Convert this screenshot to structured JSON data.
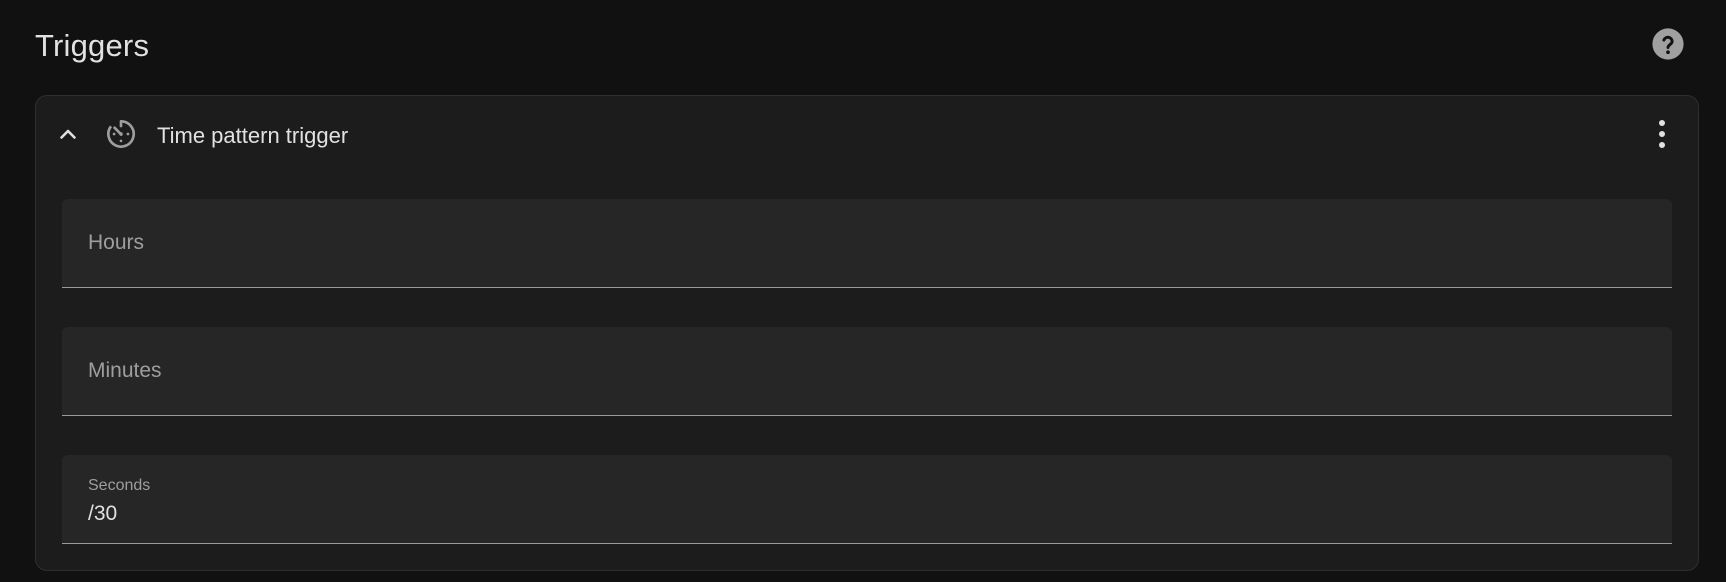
{
  "section": {
    "title": "Triggers",
    "help_icon": "help-circle-icon"
  },
  "trigger": {
    "title": "Time pattern trigger",
    "collapse_icon": "chevron-up-icon",
    "type_icon": "timer-outline-icon",
    "menu_icon": "dots-vertical-icon",
    "fields": {
      "hours": {
        "label": "Hours",
        "value": ""
      },
      "minutes": {
        "label": "Minutes",
        "value": ""
      },
      "seconds": {
        "label": "Seconds",
        "value": "/30"
      }
    }
  },
  "colors": {
    "background": "#111111",
    "card": "#1c1c1c",
    "field": "#262626",
    "text": "#e1e1e1",
    "label": "#9e9e9e"
  }
}
